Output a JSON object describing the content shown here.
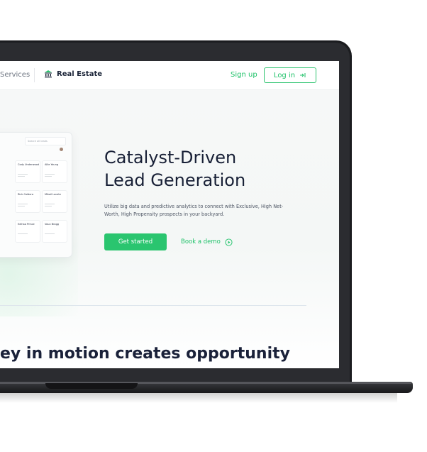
{
  "nav": {
    "services_label": "Services",
    "real_estate_label": "Real Estate",
    "signup_label": "Sign up",
    "login_label": "Log in",
    "login_icon": "login-arrow-icon"
  },
  "hero": {
    "title_line1": "Catalyst-Driven",
    "title_line2": "Lead Generation",
    "subtitle": "Utilize big data and predictive analytics to connect with Exclusive, High Net-Worth, High Propensity prospects in your backyard.",
    "get_started_label": "Get started",
    "book_demo_label": "Book a demo",
    "book_demo_icon": "play-circle-icon"
  },
  "dashboard": {
    "search_placeholder": "Search all leads",
    "cards": [
      {
        "name": "Cody Underwood"
      },
      {
        "name": "Allie Young"
      },
      {
        "name": "Rick Caldera"
      },
      {
        "name": "Mikail Lacete"
      },
      {
        "name": "Eelhaa Prince"
      },
      {
        "name": "Vaux Brogg"
      }
    ]
  },
  "section": {
    "headline": "ey in motion creates opportunity"
  },
  "colors": {
    "accent": "#2ac56f",
    "text_dark": "#182036",
    "bezel": "#1b1c1f"
  }
}
